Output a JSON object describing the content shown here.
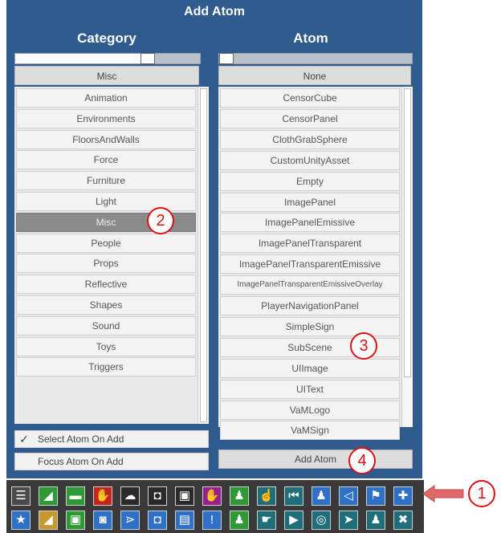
{
  "window": {
    "title": "Add Atom"
  },
  "category": {
    "header": "Category",
    "slider_fill": 0.73,
    "selected": "Misc",
    "items": [
      "Animation",
      "Environments",
      "FloorsAndWalls",
      "Force",
      "Furniture",
      "Light",
      "Misc",
      "People",
      "Props",
      "Reflective",
      "Shapes",
      "Sound",
      "Toys",
      "Triggers"
    ],
    "selected_index": 6
  },
  "atom": {
    "header": "Atom",
    "slider_fill": 0.0,
    "selected": "None",
    "items": [
      "CensorCube",
      "CensorPanel",
      "ClothGrabSphere",
      "CustomUnityAsset",
      "Empty",
      "ImagePanel",
      "ImagePanelEmissive",
      "ImagePanelTransparent",
      "ImagePanelTransparentEmissive",
      "ImagePanelTransparentEmissiveOverlay",
      "PlayerNavigationPanel",
      "SimpleSign",
      "SubScene",
      "UIImage",
      "UIText",
      "VaMLogo",
      "VaMSign"
    ]
  },
  "options": {
    "select_on_add": {
      "label": "Select Atom On Add",
      "checked": true,
      "mark": "✓"
    },
    "focus_on_add": {
      "label": "Focus Atom On Add",
      "checked": false,
      "mark": ""
    }
  },
  "add_button": "Add Atom",
  "callouts": [
    "1",
    "2",
    "3",
    "4"
  ],
  "toolbar": {
    "row1": [
      {
        "name": "menu-icon",
        "glyph": "☰",
        "bg": "#4a4a4a"
      },
      {
        "name": "edit-mode-icon",
        "glyph": "◢",
        "bg": "#2e9a35"
      },
      {
        "name": "folder-icon",
        "glyph": "▬",
        "bg": "#2e9a35"
      },
      {
        "name": "hand-red-icon",
        "glyph": "✋",
        "bg": "#c8231e"
      },
      {
        "name": "cloud-icon",
        "glyph": "☁",
        "bg": "#2a2a2a"
      },
      {
        "name": "box-icon",
        "glyph": "◘",
        "bg": "#2a2a2a"
      },
      {
        "name": "image-icon",
        "glyph": "▣",
        "bg": "#2a2a2a"
      },
      {
        "name": "hand-purple-icon",
        "glyph": "✋",
        "bg": "#9a1f8e"
      },
      {
        "name": "person-add-icon",
        "glyph": "♟",
        "bg": "#2e9a35"
      },
      {
        "name": "pointer-hand-icon",
        "glyph": "☝",
        "bg": "#1f6f7a"
      },
      {
        "name": "skip-back-icon",
        "glyph": "⏮",
        "bg": "#1f6f7a"
      },
      {
        "name": "person-icon",
        "glyph": "♟",
        "bg": "#2f70c8"
      },
      {
        "name": "send-icon",
        "glyph": "◁",
        "bg": "#2f70c8"
      },
      {
        "name": "flag-icon",
        "glyph": "⚑",
        "bg": "#2f70c8"
      },
      {
        "name": "add-icon",
        "glyph": "✚",
        "bg": "#2f70c8"
      }
    ],
    "row2": [
      {
        "name": "star-icon",
        "glyph": "★",
        "bg": "#2f70c8"
      },
      {
        "name": "edit-alt-icon",
        "glyph": "◢",
        "bg": "#c89a2e"
      },
      {
        "name": "folder-settings-icon",
        "glyph": "▣",
        "bg": "#2e9a35"
      },
      {
        "name": "camera-icon",
        "glyph": "◙",
        "bg": "#2f70c8"
      },
      {
        "name": "share-icon",
        "glyph": "⋗",
        "bg": "#2f70c8"
      },
      {
        "name": "package-icon",
        "glyph": "◘",
        "bg": "#2f70c8"
      },
      {
        "name": "document-icon",
        "glyph": "▤",
        "bg": "#2f70c8"
      },
      {
        "name": "alert-icon",
        "glyph": "!",
        "bg": "#2f70c8"
      },
      {
        "name": "person-settings-icon",
        "glyph": "♟",
        "bg": "#2e9a35"
      },
      {
        "name": "grab-icon",
        "glyph": "☛",
        "bg": "#1f6f7a"
      },
      {
        "name": "play-icon",
        "glyph": "▶",
        "bg": "#1f6f7a"
      },
      {
        "name": "target-icon",
        "glyph": "◎",
        "bg": "#1f6f7a"
      },
      {
        "name": "cursor-icon",
        "glyph": "➤",
        "bg": "#1f6f7a"
      },
      {
        "name": "people-icon",
        "glyph": "♟",
        "bg": "#1f6f7a"
      },
      {
        "name": "tools-icon",
        "glyph": "✖",
        "bg": "#1f6f7a"
      }
    ]
  },
  "colors": {
    "panel": "#2f5b8f",
    "callout": "#d11",
    "arrow": "#e06a6a"
  }
}
